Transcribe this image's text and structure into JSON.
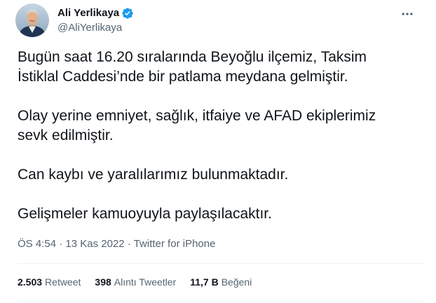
{
  "author": {
    "name": "Ali Yerlikaya",
    "handle": "@AliYerlikaya",
    "verified": true,
    "avatar_icon": "profile-photo-icon"
  },
  "tweet": {
    "paragraphs": [
      "Bugün saat 16.20 sıralarında Beyoğlu ilçemiz, Taksim\nİstiklal Caddesi’nde bir patlama meydana gelmiştir.",
      "Olay yerine emniyet, sağlık, itfaiye ve AFAD ekiplerimiz\nsevk edilmiştir.",
      "Can kaybı ve yaralılarımız bulunmaktadır.",
      "Gelişmeler kamuoyuyla paylaşılacaktır."
    ]
  },
  "meta": {
    "time": "ÖS 4:54",
    "separator": "·",
    "date": "13 Kas 2022",
    "source": "Twitter for iPhone"
  },
  "stats": {
    "retweets_count": "2.503",
    "retweets_label": "Retweet",
    "quotes_count": "398",
    "quotes_label": "Alıntı Tweetler",
    "likes_count": "11,7 B",
    "likes_label": "Beğeni"
  },
  "colors": {
    "text_primary": "#0f1419",
    "text_secondary": "#536471",
    "verified_blue": "#1d9bf0",
    "divider": "#eff3f4"
  },
  "icons": {
    "more": "more-horizontal-icon",
    "verified": "verified-badge-icon"
  }
}
